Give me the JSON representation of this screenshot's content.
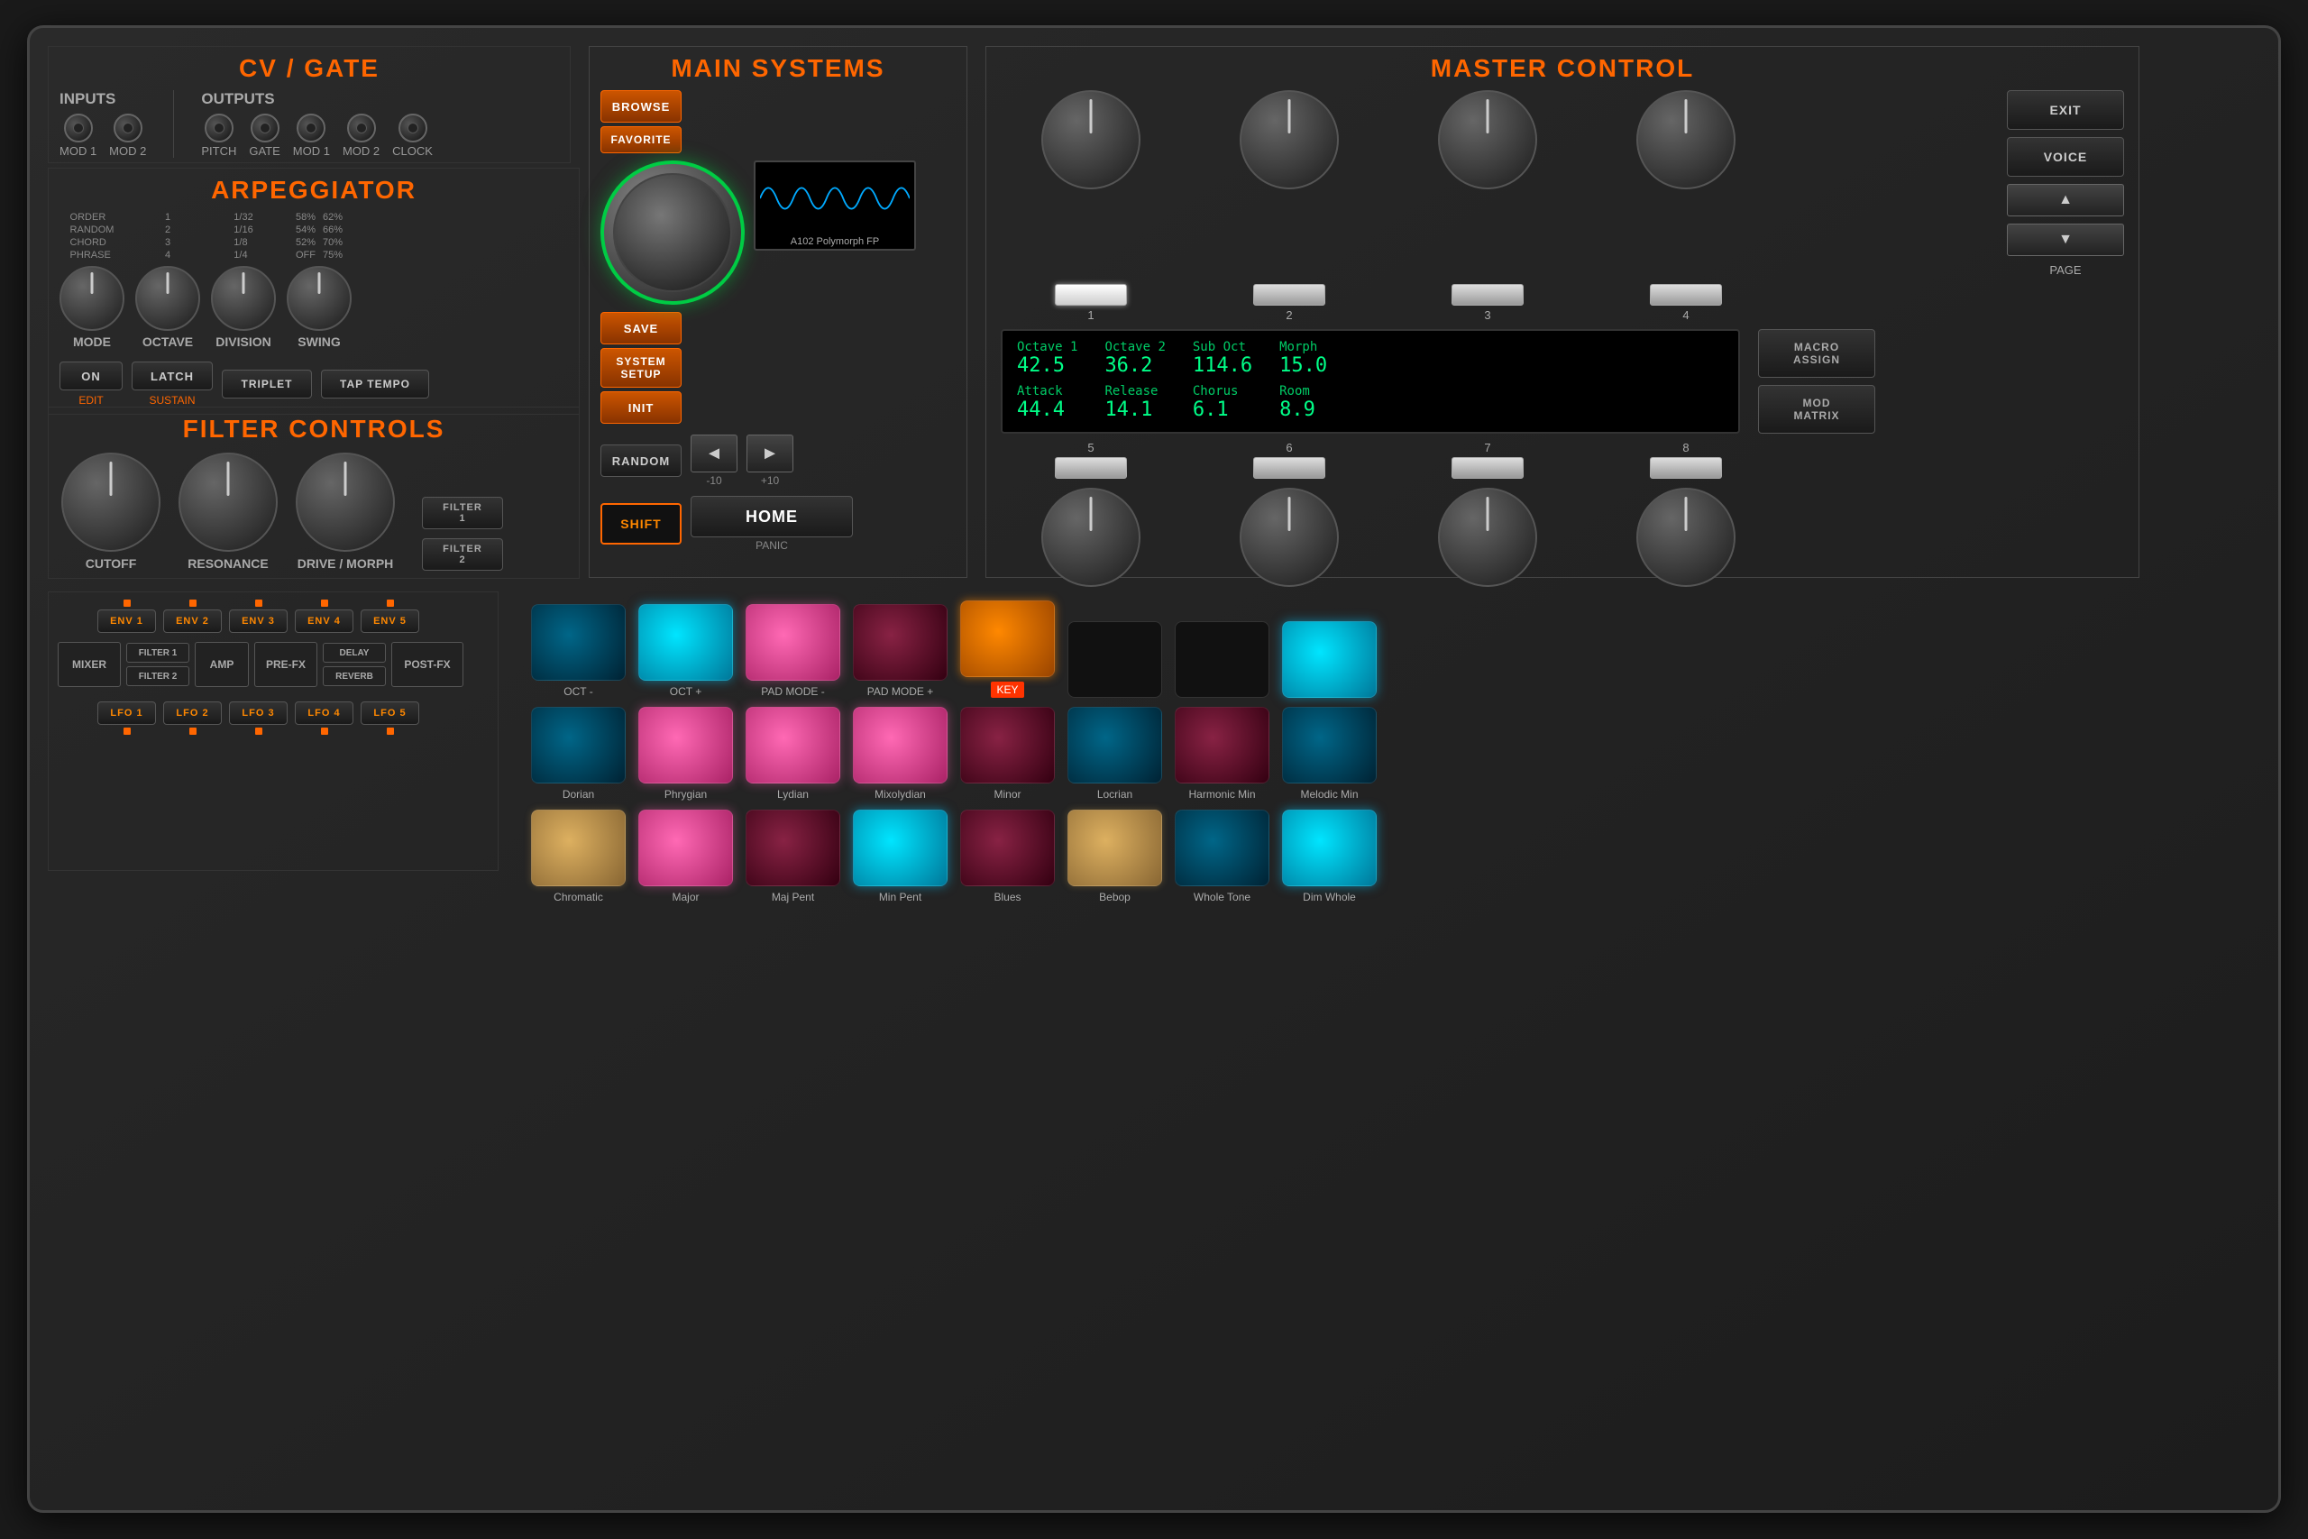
{
  "sections": {
    "cv_gate": {
      "title": "CV / GATE",
      "inputs_label": "INPUTS",
      "outputs_label": "OUTPUTS",
      "input_jacks": [
        "MOD 1",
        "MOD 2"
      ],
      "output_jacks": [
        "PITCH",
        "GATE",
        "MOD 1",
        "MOD 2",
        "CLOCK"
      ]
    },
    "arpeggiator": {
      "title": "ARPEGGIATOR",
      "mode_label": "MODE",
      "octave_label": "OCTAVE",
      "division_label": "DIVISION",
      "swing_label": "SWING",
      "order_options": [
        "ORDER",
        "RANDOM",
        "CHORD",
        "PHRASE"
      ],
      "division_options": [
        "1/32",
        "1/16",
        "1/8",
        "1/4"
      ],
      "swing_values": [
        "58%",
        "54%",
        "52%",
        "OFF"
      ],
      "swing_values2": [
        "62%",
        "66%",
        "70%",
        "75%"
      ],
      "btn_on": "ON",
      "btn_latch": "LATCH",
      "btn_triplet": "TRIPLET",
      "btn_tap": "TAP TEMPO",
      "btn_edit": "EDIT",
      "btn_sustain": "SUSTAIN"
    },
    "filter_controls": {
      "title": "FILTER CONTROLS",
      "cutoff_label": "CUTOFF",
      "resonance_label": "RESONANCE",
      "drive_morph_label": "DRIVE / MORPH",
      "filter1_label": "FILTER 1",
      "filter2_label": "FILTER 2"
    },
    "main_systems": {
      "title": "MAIN SYSTEMS",
      "btn_browse": "BROWSE",
      "btn_favorite": "FAVORITE",
      "btn_save": "SAVE",
      "btn_system_setup": "SYSTEM SETUP",
      "btn_init": "INIT",
      "btn_random": "RANDOM",
      "btn_shift": "SHIFT",
      "btn_home": "HOME",
      "btn_panic": "PANIC",
      "nav_minus": "◄",
      "nav_plus": "►",
      "nav_minus10": "-10",
      "nav_plus10": "+10",
      "patch_name": "A102 Polymorph FP"
    },
    "master_control": {
      "title": "MASTER CONTROL",
      "params": {
        "octave1_label": "Octave 1",
        "octave1_val": "42.5",
        "octave2_label": "Octave 2",
        "octave2_val": "36.2",
        "sub_oct_label": "Sub Oct",
        "sub_oct_val": "114.6",
        "morph_label": "Morph",
        "morph_val": "15.0",
        "attack_label": "Attack",
        "attack_val": "44.4",
        "release_label": "Release",
        "release_val": "14.1",
        "chorus_label": "Chorus",
        "chorus_val": "6.1",
        "room_label": "Room",
        "room_val": "8.9"
      },
      "slot_numbers": [
        "1",
        "2",
        "3",
        "4",
        "5",
        "6",
        "7",
        "8"
      ],
      "btn_voice": "VOICE",
      "btn_page_up": "▲",
      "btn_page_down": "▼",
      "btn_page": "PAGE",
      "btn_macro": "MACRO ASSIGN",
      "btn_mod_matrix": "MOD MATRIX",
      "btn_exit": "EXIT"
    },
    "signal_flow": {
      "mixer_label": "MIXER",
      "env_labels": [
        "ENV 1",
        "ENV 2",
        "ENV 3",
        "ENV 4",
        "ENV 5"
      ],
      "lfo_labels": [
        "LFO 1",
        "LFO 2",
        "LFO 3",
        "LFO 4",
        "LFO 5"
      ],
      "filter1_label": "FILTER 1",
      "filter2_label": "FILTER 2",
      "amp_label": "AMP",
      "pre_fx_label": "PRE-FX",
      "delay_label": "DELAY",
      "reverb_label": "REVERB",
      "post_fx_label": "POST-FX"
    },
    "pads": {
      "row1_labels": [
        "OCT -",
        "OCT +",
        "PAD MODE -",
        "PAD MODE +",
        "KEY",
        "",
        "",
        ""
      ],
      "row2_labels": [
        "Dorian",
        "Phrygian",
        "Lydian",
        "Mixolydian",
        "Minor",
        "Locrian",
        "Harmonic Min",
        "Melodic Min"
      ],
      "row3_labels": [
        "Chromatic",
        "Major",
        "Maj Pent",
        "Min Pent",
        "Blues",
        "Bebop",
        "Whole Tone",
        "Dim Whole"
      ]
    }
  }
}
